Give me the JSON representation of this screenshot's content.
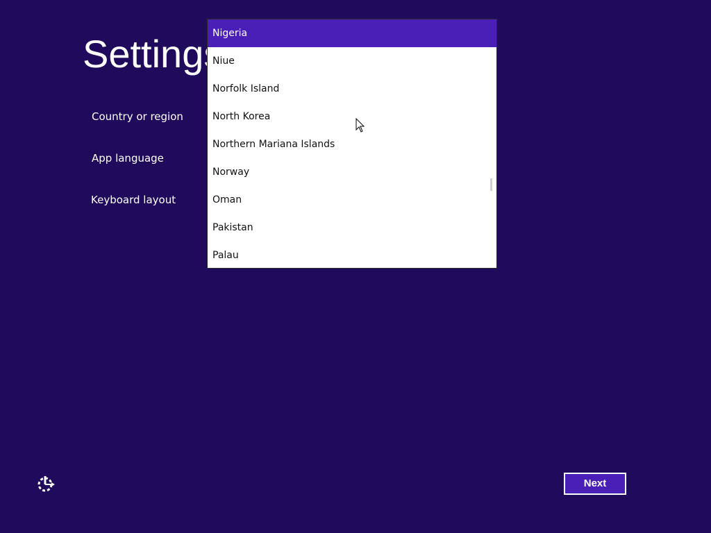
{
  "page": {
    "title": "Settings"
  },
  "fields": {
    "country_label": "Country or region",
    "language_label": "App language",
    "keyboard_label": "Keyboard layout"
  },
  "country_dropdown": {
    "selected": "Nigeria",
    "items": [
      "Nigeria",
      "Niue",
      "Norfolk Island",
      "North Korea",
      "Northern Mariana Islands",
      "Norway",
      "Oman",
      "Pakistan",
      "Palau"
    ]
  },
  "footer": {
    "next_label": "Next",
    "ease_of_access_icon": "ease-of-access-icon"
  },
  "colors": {
    "background": "#1f0a5c",
    "accent": "#4a1fb8",
    "text": "#ffffff",
    "list_text": "#111111"
  }
}
